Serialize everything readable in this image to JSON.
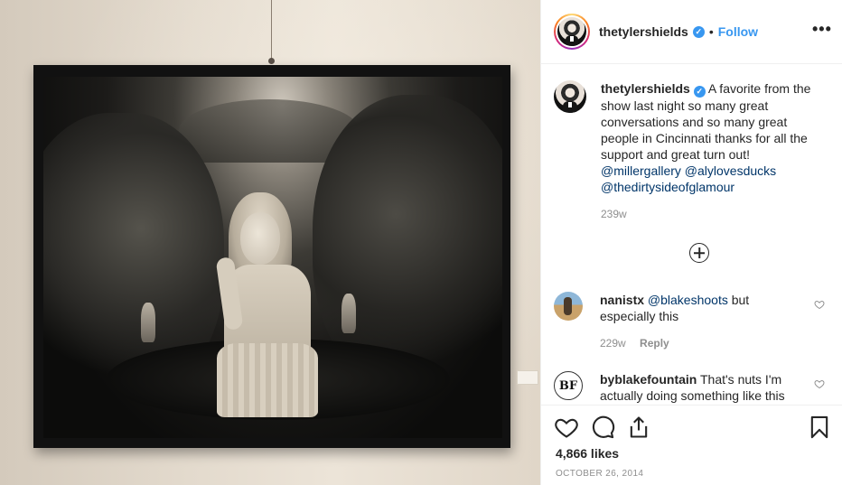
{
  "post": {
    "author": "thetylershields",
    "follow_label": "Follow",
    "separator": "•",
    "verified_mark": "✓",
    "more_glyph": "•••",
    "image_description_icon": "photo-of-framed-print",
    "caption": {
      "author": "thetylershields",
      "text": "A favorite from the show last night so many great conversations and so many great people in Cincinnati thanks for all the support and great turn out!",
      "mentions": [
        "@millergallery",
        "@alylovesducks",
        "@thedirtysideofglamour"
      ],
      "age": "239w"
    },
    "comments": [
      {
        "author": "nanistx",
        "mention": "@blakeshoots",
        "text_after": " but especially this",
        "age": "229w",
        "reply_label": "Reply"
      },
      {
        "author": "byblakefountain",
        "avatar_text": "BF",
        "text": "That's nuts I'm actually doing something like this"
      }
    ],
    "likes": "4,866 likes",
    "date": "OCTOBER 26, 2014"
  },
  "colors": {
    "link": "#3897f0",
    "mention": "#003569",
    "muted": "#8e8e8e",
    "text": "#262626"
  }
}
